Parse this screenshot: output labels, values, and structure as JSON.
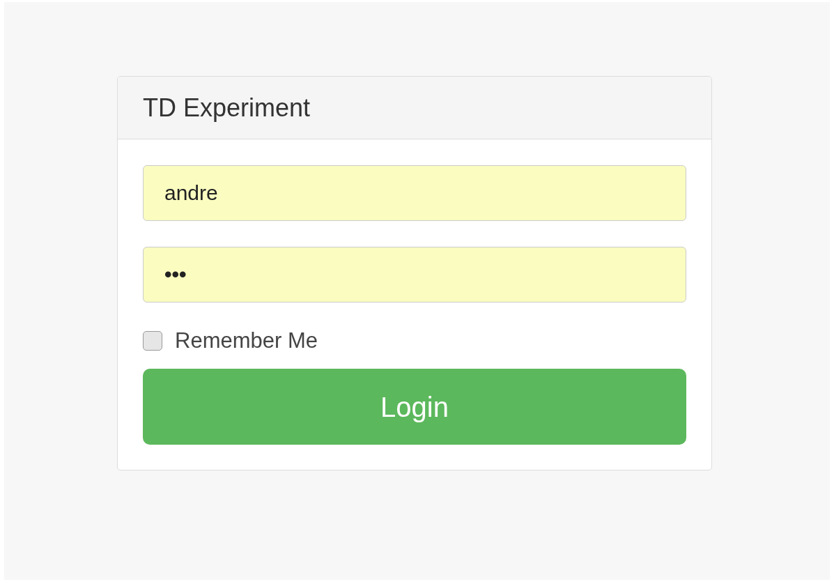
{
  "panel": {
    "title": "TD Experiment"
  },
  "fields": [
    {
      "kind": "text",
      "value": "andre"
    },
    {
      "kind": "password",
      "value": "•••"
    }
  ],
  "remember": {
    "label": "Remember Me",
    "checked": false
  },
  "login_button": {
    "label": "Login"
  }
}
